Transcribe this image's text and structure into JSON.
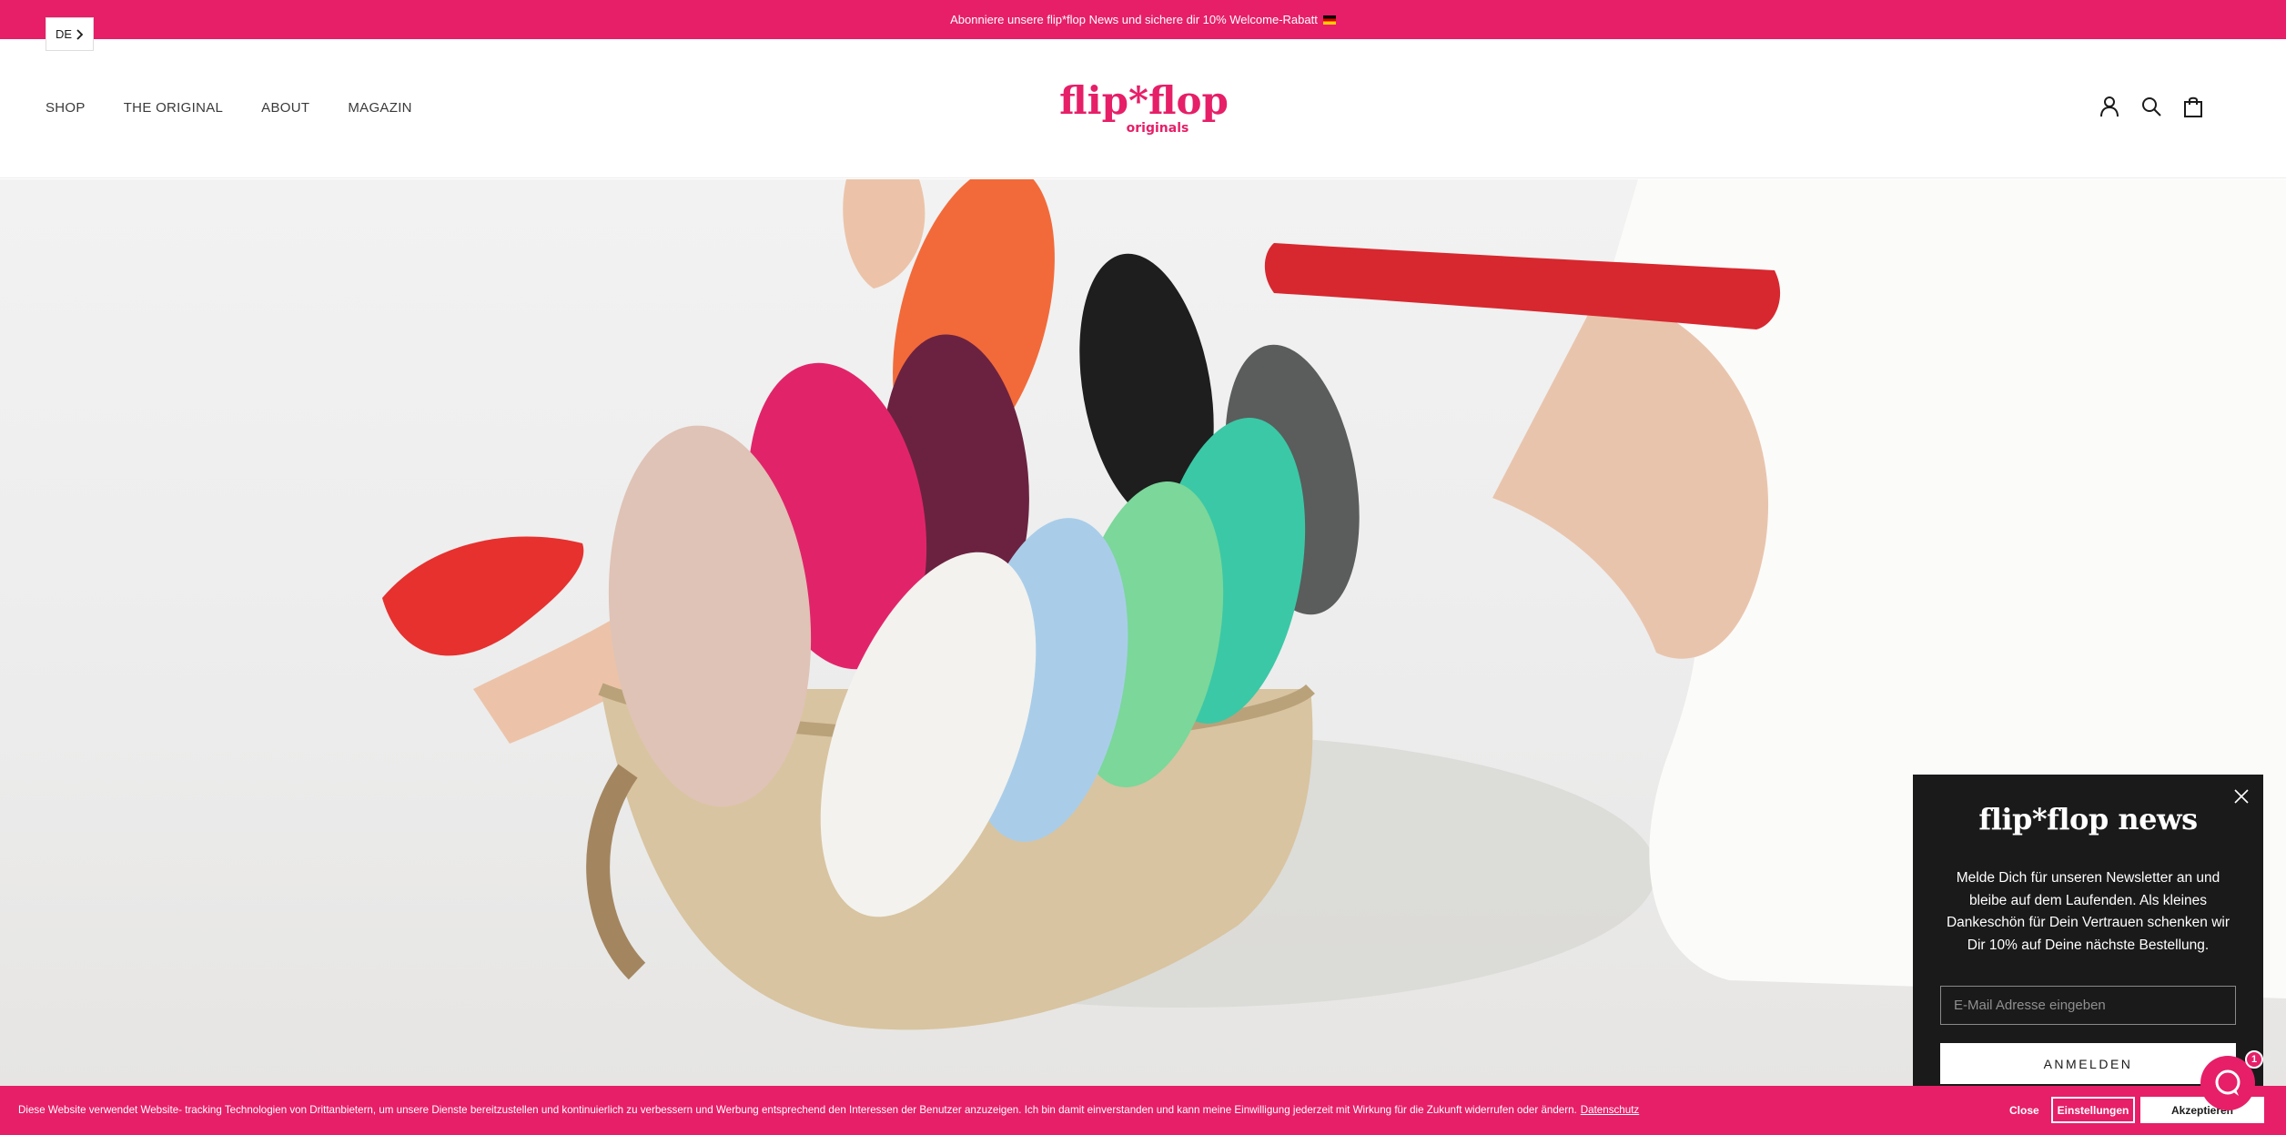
{
  "announcement": {
    "text": "Abonniere unsere flip*flop News und sichere dir 10% Welcome-Rabatt"
  },
  "language": {
    "label": "DE"
  },
  "nav": {
    "items": [
      {
        "label": "SHOP"
      },
      {
        "label": "THE ORIGINAL"
      },
      {
        "label": "ABOUT"
      },
      {
        "label": "MAGAZIN"
      }
    ]
  },
  "logo": {
    "text": "flip*flop",
    "sub": "originals"
  },
  "icons": {
    "account": "user-icon",
    "search": "search-icon",
    "cart": "shopping-bag-icon"
  },
  "colors": {
    "brand": "#e61f68",
    "popup_bg": "#1a1a1a"
  },
  "newsletter": {
    "title": "flip*flop news",
    "text": "Melde Dich für unseren Newsletter an und bleibe auf dem Laufenden. Als kleines Dankeschön für Dein Vertrauen schenken wir Dir 10% auf Deine nächste Bestellung.",
    "email_placeholder": "E-Mail Adresse eingeben",
    "submit_label": "ANMELDEN"
  },
  "chat": {
    "badge_count": "1"
  },
  "cookie": {
    "text": "Diese Website verwendet Website- tracking Technologien von Drittanbietern, um unsere Dienste bereitzustellen und kontinuierlich zu verbessern und Werbung entsprechend den Interessen der Benutzer anzuzeigen. Ich bin damit einverstanden und kann meine Einwilligung jederzeit mit Wirkung für die Zukunft widerrufen oder ändern.",
    "link_label": "Datenschutz",
    "close_label": "Close",
    "settings_label": "Einstellungen",
    "accept_label": "Akzeptieren"
  }
}
